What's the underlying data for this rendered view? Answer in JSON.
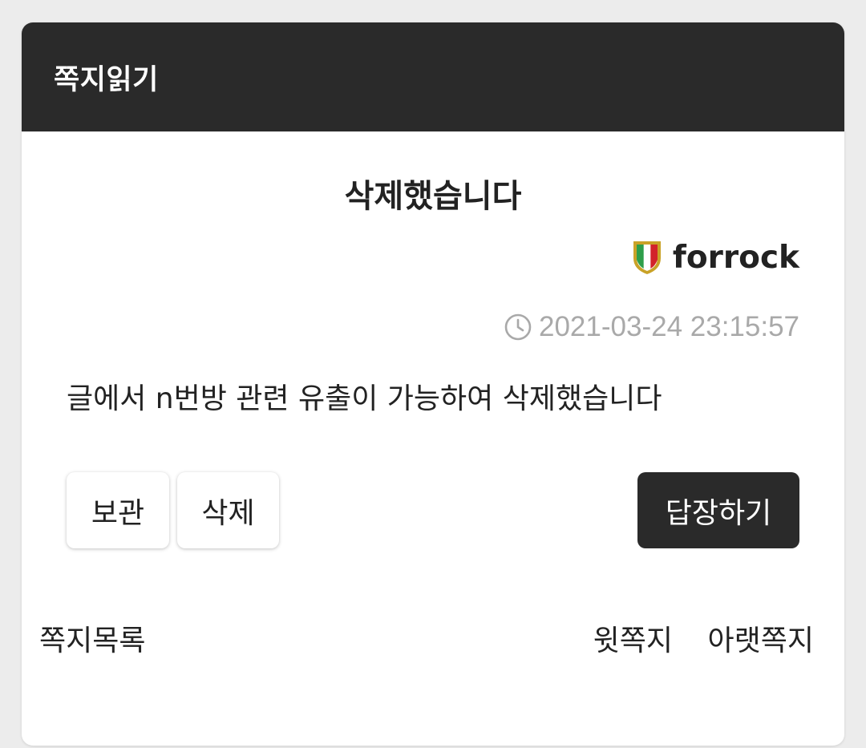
{
  "header": {
    "title": "쪽지읽기"
  },
  "message": {
    "subject": "삭제했습니다",
    "sender": "forrock",
    "sender_badge": "italy-shield-badge-icon",
    "timestamp": "2021-03-24 23:15:57",
    "body": "글에서 n번방 관련 유출이 가능하여 삭제했습니다"
  },
  "actions": {
    "archive_label": "보관",
    "delete_label": "삭제",
    "reply_label": "답장하기"
  },
  "footer": {
    "list_label": "쪽지목록",
    "prev_label": "윗쪽지",
    "next_label": "아랫쪽지"
  },
  "colors": {
    "header_bg": "#2a2a2a",
    "timestamp": "#a9a9a9",
    "badge_green": "#2e9e4a",
    "badge_red": "#d2232a",
    "badge_gold": "#c9a227"
  }
}
